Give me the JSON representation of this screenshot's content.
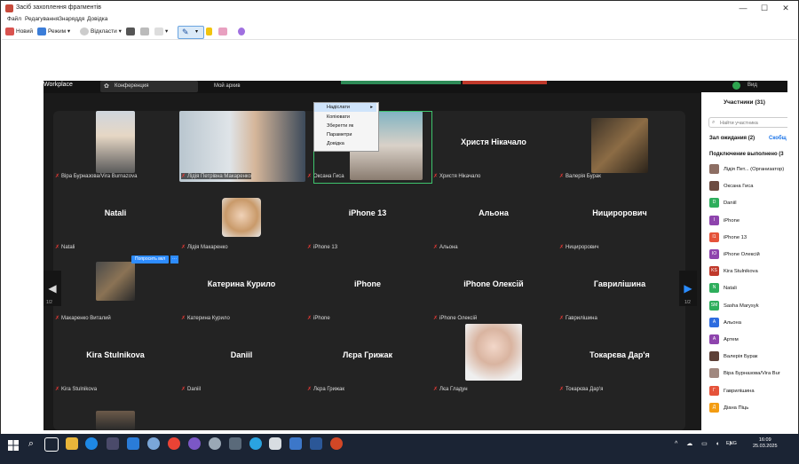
{
  "window": {
    "title": "Засіб захоплення фрагментів",
    "controls": [
      "—",
      "☐",
      "✕"
    ]
  },
  "menu": [
    "Файл",
    "Редагування",
    "Знаряддя",
    "Довідка"
  ],
  "toolbar": {
    "new_label": "Новий",
    "mode_label": "Режим",
    "delay_label": "Відкласти"
  },
  "zoom": {
    "app_name": "Workplace",
    "conference_tab": "Конференция",
    "my_id_tab": "Мой архив",
    "view_label": "Вид",
    "participants_title": "Участники (31)",
    "search_placeholder": "Найти участника",
    "waiting_room": "Зал ожидания (2)",
    "waiting_action": "Скобщ",
    "connected": "Подключение выполнено (3",
    "ask_button": "Попросить вкл",
    "page_indicator": "1/2",
    "dropdown": [
      "Надіслати",
      "Копіювати",
      "Зберегти як",
      "Параметри",
      "Довідка"
    ],
    "participants": [
      {
        "name": "Лідія Пет... (Организатор)",
        "initials": "",
        "color": "#8d6e63"
      },
      {
        "name": "Оксана Гиса",
        "initials": "",
        "color": "#6d4c41"
      },
      {
        "name": "Daniil",
        "initials": "D",
        "color": "#2eae5c"
      },
      {
        "name": "iPhone",
        "initials": "I",
        "color": "#8e44ad"
      },
      {
        "name": "iPhone 13",
        "initials": "I1",
        "color": "#e5533a"
      },
      {
        "name": "iPhone Олексій",
        "initials": "IO",
        "color": "#8e44ad"
      },
      {
        "name": "Kira Stulnikova",
        "initials": "KS",
        "color": "#c0392b"
      },
      {
        "name": "Natali",
        "initials": "N",
        "color": "#2eae5c"
      },
      {
        "name": "Sasha Marysyk",
        "initials": "SM",
        "color": "#2eae5c"
      },
      {
        "name": "Альона",
        "initials": "А",
        "color": "#2d6cdf"
      },
      {
        "name": "Артем",
        "initials": "А",
        "color": "#8e44ad"
      },
      {
        "name": "Валерія Бурак",
        "initials": "",
        "color": "#5d4037"
      },
      {
        "name": "Віра Бурназова/Vira Bur",
        "initials": "",
        "color": "#a1887f"
      },
      {
        "name": "Гаврилішина",
        "initials": "Г",
        "color": "#e5533a"
      },
      {
        "name": "Діана Піць",
        "initials": "Д",
        "color": "#f39c12"
      }
    ],
    "grid": [
      {
        "label": "Віра Бурназова/Vira Burnazova",
        "name": ""
      },
      {
        "label": "Лідія Петрівна Макаренко",
        "name": ""
      },
      {
        "label": "Оксана Гиса",
        "name": ""
      },
      {
        "label": "Христя Нікачало",
        "name": "Христя Нікачало"
      },
      {
        "label": "Валерія Бурак",
        "name": ""
      },
      {
        "label": "Natali",
        "name": "Natali"
      },
      {
        "label": "Лідія Макаренко",
        "name": ""
      },
      {
        "label": "iPhone 13",
        "name": "iPhone 13"
      },
      {
        "label": "Альона",
        "name": "Альона"
      },
      {
        "label": "Ницирорович",
        "name": "Ницирорович"
      },
      {
        "label": "Макаренко Виталий",
        "name": ""
      },
      {
        "label": "Катерина Курило",
        "name": "Катерина Курило"
      },
      {
        "label": "iPhone",
        "name": "iPhone"
      },
      {
        "label": "iPhone Олексій",
        "name": "iPhone Олексій"
      },
      {
        "label": "Гаврилішина",
        "name": "Гаврилішина"
      },
      {
        "label": "Kira Stulnikova",
        "name": "Kira Stulnikova"
      },
      {
        "label": "Daniil",
        "name": "Daniil"
      },
      {
        "label": "Лєра Грижак",
        "name": "Лєра Грижак"
      },
      {
        "label": "Лєа Гладун",
        "name": ""
      },
      {
        "label": "Токарєва Дар'я",
        "name": "Токарєва Дар'я"
      }
    ]
  },
  "taskbar": {
    "time": "16:09",
    "date": "25.03.2025",
    "lang": "ENG"
  },
  "colors": {
    "zoom_bg": "#1a1a1a",
    "grid_bg": "#232323",
    "accent": "#2d8cff",
    "active_speaker": "#3ec46d",
    "taskbar": "#1b2434"
  }
}
